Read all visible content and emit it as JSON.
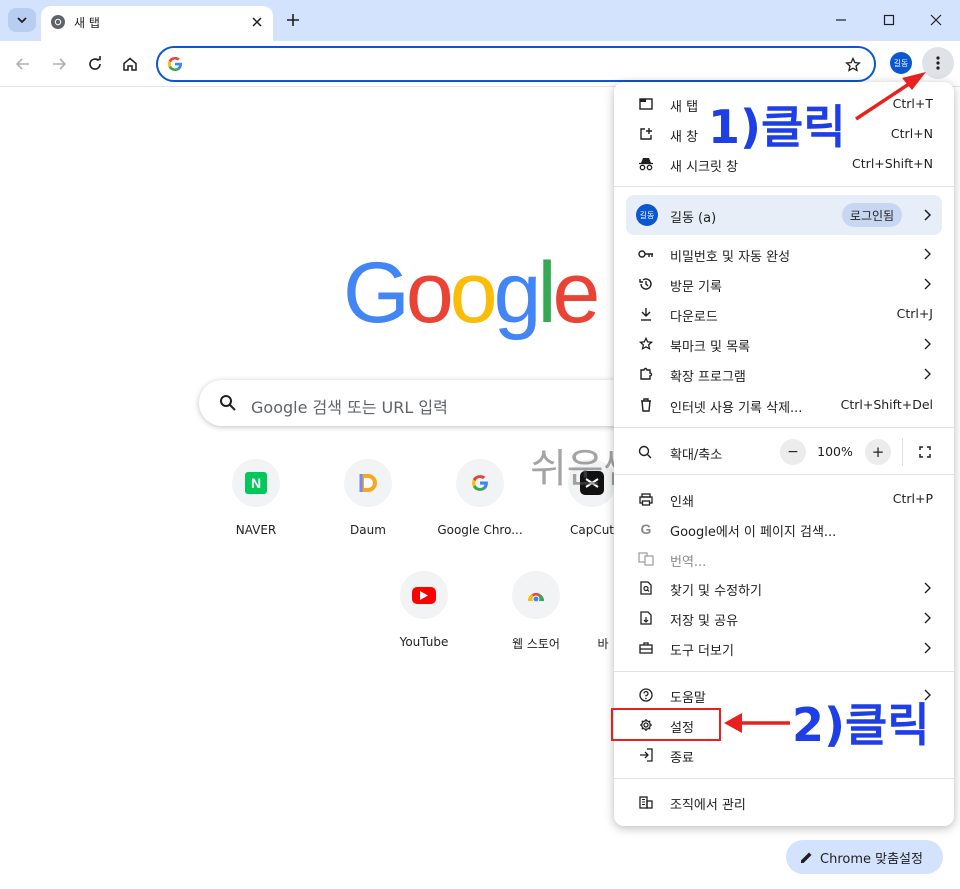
{
  "browser": {
    "tab_title": "새 탭",
    "omnibox_value": "",
    "profile_initials": "길동"
  },
  "ntp": {
    "search_placeholder": "Google 검색 또는 URL 입력",
    "watermark": "쉬운쌤",
    "customize_label": "Chrome 맞춤설정",
    "shortcuts": [
      {
        "label": "NAVER",
        "icon": "naver-icon"
      },
      {
        "label": "Daum",
        "icon": "daum-icon"
      },
      {
        "label": "Google Chro...",
        "icon": "google-icon"
      },
      {
        "label": "CapCut",
        "icon": "capcut-icon"
      },
      {
        "label": "YouTube",
        "icon": "youtube-icon"
      },
      {
        "label": "웹 스토어",
        "icon": "webstore-icon"
      },
      {
        "label": "바",
        "icon": "add-icon"
      }
    ]
  },
  "menu": {
    "new_tab": {
      "label": "새 탭",
      "shortcut": "Ctrl+T"
    },
    "new_window": {
      "label": "새 창",
      "shortcut": "Ctrl+N"
    },
    "incognito": {
      "label": "새 시크릿 창",
      "shortcut": "Ctrl+Shift+N"
    },
    "profile": {
      "avatar": "길동",
      "name": "길동 (a)",
      "chip": "로그인됨"
    },
    "passwords": {
      "label": "비밀번호 및 자동 완성"
    },
    "history": {
      "label": "방문 기록"
    },
    "downloads": {
      "label": "다운로드",
      "shortcut": "Ctrl+J"
    },
    "bookmarks": {
      "label": "북마크 및 목록"
    },
    "extensions": {
      "label": "확장 프로그램"
    },
    "clear_data": {
      "label": "인터넷 사용 기록 삭제...",
      "shortcut": "Ctrl+Shift+Del"
    },
    "zoom": {
      "label": "확대/축소",
      "minus": "−",
      "value": "100%",
      "plus": "+"
    },
    "print": {
      "label": "인쇄",
      "shortcut": "Ctrl+P"
    },
    "search_page": {
      "label": "Google에서 이 페이지 검색..."
    },
    "translate": {
      "label": "번역..."
    },
    "find_edit": {
      "label": "찾기 및 수정하기"
    },
    "save_share": {
      "label": "저장 및 공유"
    },
    "more_tools": {
      "label": "도구 더보기"
    },
    "help": {
      "label": "도움말"
    },
    "settings": {
      "label": "설정"
    },
    "exit": {
      "label": "종료"
    },
    "managed": {
      "label": "조직에서 관리"
    }
  },
  "annotations": {
    "step1": "1)클릭",
    "step2": "2)클릭",
    "color_text": "#1f3fe6",
    "color_marker": "#e8211f"
  }
}
